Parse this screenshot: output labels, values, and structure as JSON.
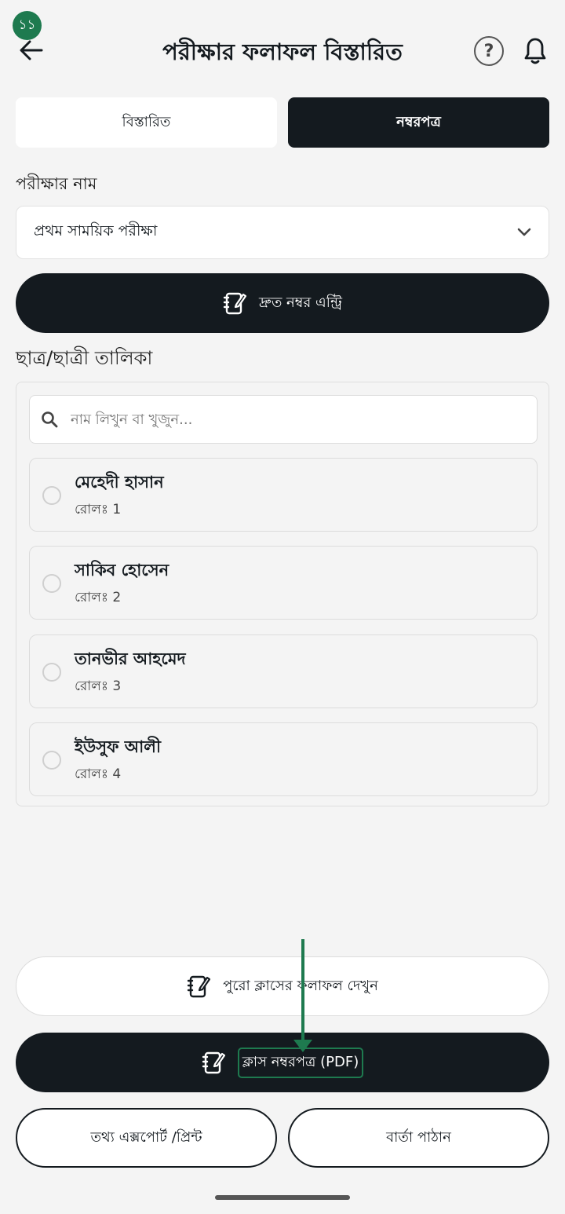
{
  "status": {
    "badge": "১১"
  },
  "header": {
    "title": "পরীক্ষার ফলাফল বিস্তারিত",
    "help_symbol": "?",
    "back_icon": "arrow-left-icon",
    "help_icon": "question-circle-icon",
    "notification_icon": "bell-icon"
  },
  "tabs": [
    {
      "label": "বিস্তারিত",
      "active": false
    },
    {
      "label": "নম্বরপত্র",
      "active": true
    }
  ],
  "exam": {
    "label": "পরীক্ষার নাম",
    "selected": "প্রথম সাময়িক পরীক্ষা"
  },
  "quick_entry": {
    "label": "দ্রুত নম্বর এন্ট্রি",
    "icon": "notebook-edit-icon"
  },
  "students_section": {
    "title": "ছাত্র/ছাত্রী তালিকা",
    "search_placeholder": "নাম লিখুন বা খুজুন...",
    "students": [
      {
        "name": "মেহেদী হাসান",
        "roll": "রোলঃ 1"
      },
      {
        "name": "সাকিব হোসেন",
        "roll": "রোলঃ 2"
      },
      {
        "name": "তানভীর আহমেদ",
        "roll": "রোলঃ 3"
      },
      {
        "name": "ইউসুফ আলী",
        "roll": "রোলঃ 4"
      }
    ]
  },
  "actions": {
    "view_class_results": "পুরো ক্লাসের ফলাফল দেখুন",
    "class_marksheet_pdf": "ক্লাস নম্বরপত্র (PDF)",
    "export_print": "তথ্য এক্সপোর্ট /প্রিন্ট",
    "send_message": "বার্তা পাঠান"
  },
  "colors": {
    "primary_dark": "#141a1f",
    "accent_green": "#1e7a4f",
    "background": "#f4f4f4"
  }
}
